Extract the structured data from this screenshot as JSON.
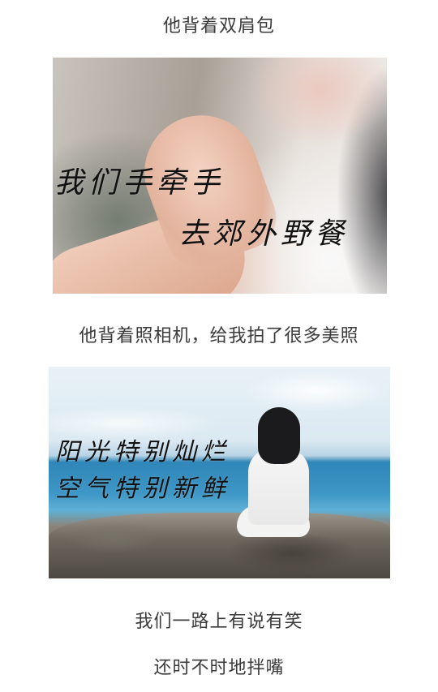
{
  "captions": {
    "caption1": "他背着双肩包",
    "caption2": "他背着照相机，给我拍了很多美照",
    "caption3": "我们一路上有说有笑",
    "caption4": "还时不时地拌嘴"
  },
  "photo1": {
    "overlay_line1": "我们手牵手",
    "overlay_line2": "去郊外野餐"
  },
  "photo2": {
    "overlay_line1": "阳光特别灿烂",
    "overlay_line2": "空气特别新鲜"
  }
}
